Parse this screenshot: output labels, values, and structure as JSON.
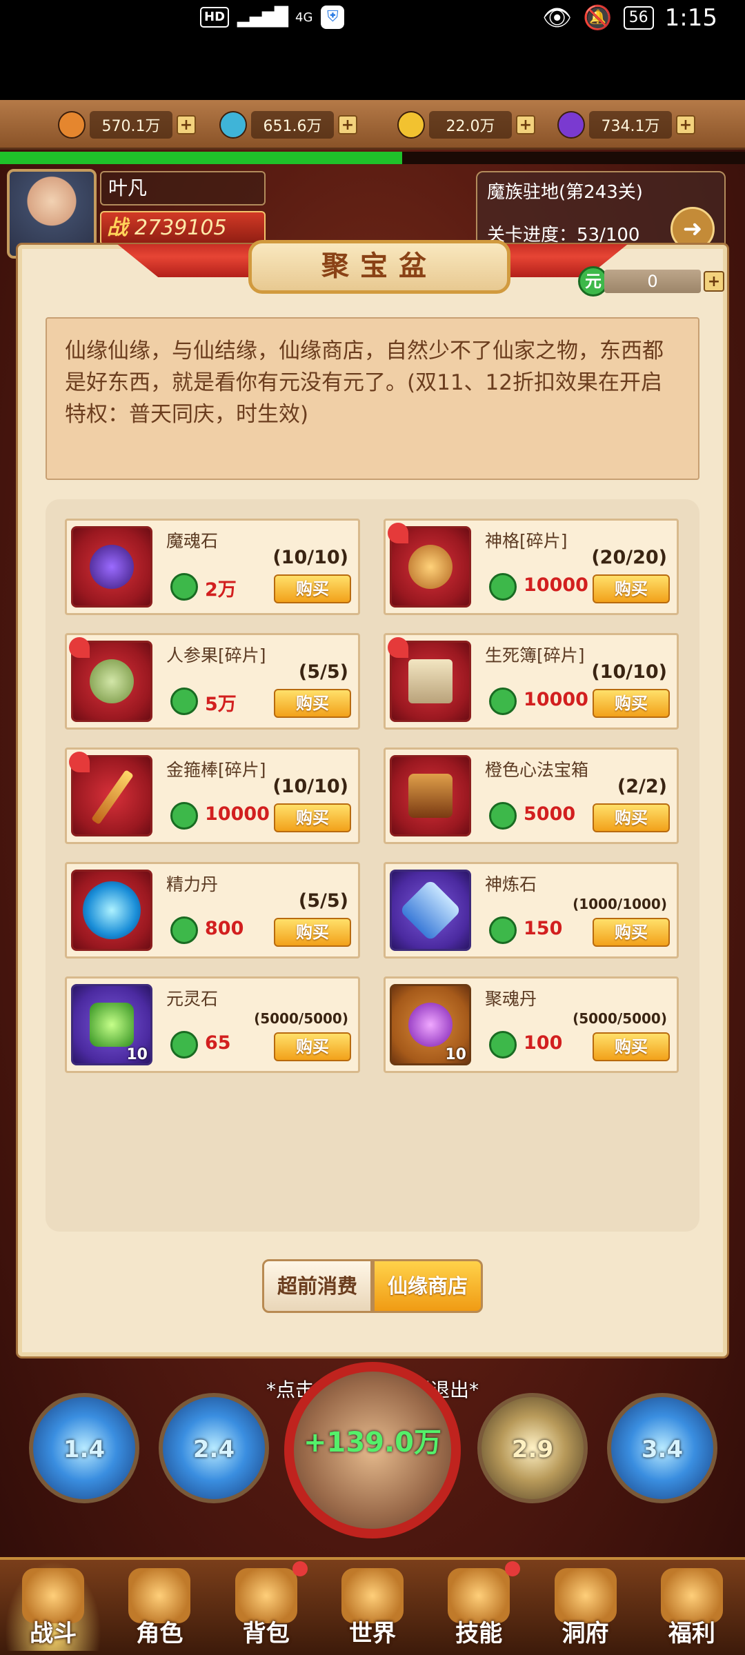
{
  "status_bar": {
    "hd": "HD",
    "network": "4G",
    "time": "1:15",
    "battery": "56"
  },
  "currencies": [
    {
      "icon": "gold-ingot-icon",
      "value": "570.1万",
      "color": "#e5862e"
    },
    {
      "icon": "crystal-orb-icon",
      "value": "651.6万",
      "color": "#3fb4d8"
    },
    {
      "icon": "gold-coin-icon",
      "value": "22.0万",
      "color": "#f2c230"
    },
    {
      "icon": "purple-orb-icon",
      "value": "734.1万",
      "color": "#7a3ad0"
    }
  ],
  "exp_progress": 0.54,
  "player": {
    "name": "叶凡",
    "power_label": "战",
    "power": "2739105"
  },
  "stage": {
    "name": "魔族驻地(第243关)",
    "progress": "关卡进度：53/100"
  },
  "dialog": {
    "title": "聚宝盆",
    "yuan_balance": "0",
    "description": "仙缘仙缘，与仙结缘，仙缘商店，自然少不了仙家之物，东西都是好东西，就是看你有元没有元了。(双11、12折扣效果在开启特权：普天同庆，时生效)"
  },
  "buy_label": "购买",
  "items": [
    {
      "name": "魔魂石",
      "limit": "(10/10)",
      "cost": "2万",
      "icon_color": "red",
      "count": ""
    },
    {
      "name": "神格[碎片]",
      "limit": "(20/20)",
      "cost": "10000",
      "icon_color": "red",
      "count": ""
    },
    {
      "name": "人参果[碎片]",
      "limit": "(5/5)",
      "cost": "5万",
      "icon_color": "red",
      "count": ""
    },
    {
      "name": "生死簿[碎片]",
      "limit": "(10/10)",
      "cost": "10000",
      "icon_color": "red",
      "count": ""
    },
    {
      "name": "金箍棒[碎片]",
      "limit": "(10/10)",
      "cost": "10000",
      "icon_color": "red",
      "count": ""
    },
    {
      "name": "橙色心法宝箱",
      "limit": "(2/2)",
      "cost": "5000",
      "icon_color": "red",
      "count": ""
    },
    {
      "name": "精力丹",
      "limit": "(5/5)",
      "cost": "800",
      "icon_color": "red",
      "count": ""
    },
    {
      "name": "神炼石",
      "limit": "(1000/1000)",
      "cost": "150",
      "icon_color": "purple",
      "count": ""
    },
    {
      "name": "元灵石",
      "limit": "(5000/5000)",
      "cost": "65",
      "icon_color": "purple",
      "count": "10"
    },
    {
      "name": "聚魂丹",
      "limit": "(5000/5000)",
      "cost": "100",
      "icon_color": "brown",
      "count": "10"
    }
  ],
  "tabs": {
    "prepaid": "超前消费",
    "shop": "仙缘商店"
  },
  "exit_hint": "*点击任意空白位置退出*",
  "skills": {
    "s1": "1.4",
    "s2": "2.4",
    "gain": "+139.0万",
    "s3": "2.9",
    "s4": "3.4"
  },
  "nav": [
    {
      "label": "战斗",
      "active": true
    },
    {
      "label": "角色"
    },
    {
      "label": "背包"
    },
    {
      "label": "世界"
    },
    {
      "label": "技能"
    },
    {
      "label": "洞府"
    },
    {
      "label": "福利"
    }
  ]
}
